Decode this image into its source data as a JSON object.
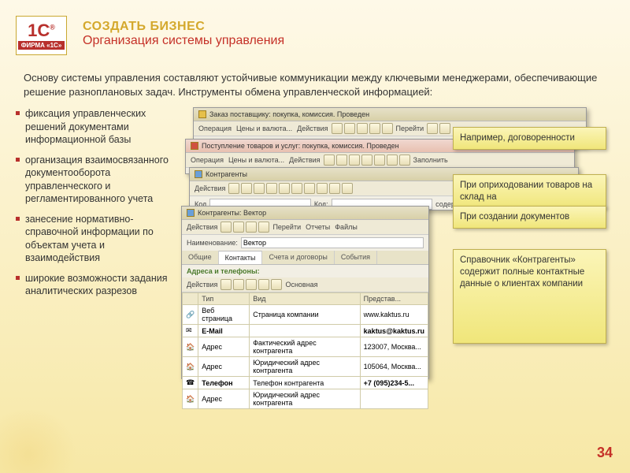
{
  "header": {
    "logo_top": "1С",
    "logo_reg": "®",
    "logo_firm": "ФИРМА «1С»",
    "title_gold": "СОЗДАТЬ БИЗНЕС",
    "title_red": "Организация системы управления"
  },
  "intro": "Основу системы управления составляют устойчивые коммуникации между ключевыми менеджерами, обеспечивающие решение разноплановых задач. Инструменты обмена управленческой информацией:",
  "bullets": [
    "фиксация управленческих решений документами информационной базы",
    "организация взаимосвязанного документооборота управленческого и регламентированного учета",
    "занесение нормативно-справочной информации по объектам учета и взаимодействия",
    "широкие возможности задания аналитических разрезов"
  ],
  "win1": {
    "title": "Заказ поставщику: покупка, комиссия. Проведен",
    "menu1": "Операция",
    "menu2": "Цены и валюта...",
    "menu3": "Действия",
    "menu_go": "Перейти"
  },
  "win2": {
    "title": "Поступление товаров и услуг: покупка, комиссия. Проведен",
    "menu1": "Операция",
    "menu2": "Цены и валюта...",
    "menu3": "Действия",
    "menu_fill": "Заполнить"
  },
  "win3": {
    "title": "Контрагенты",
    "act": "Действия",
    "kod": "Код",
    "kod2": "Код:",
    "contain": "содержит:"
  },
  "win4": {
    "title": "Контрагенты: Вектор",
    "act": "Действия",
    "go": "Перейти",
    "rep": "Отчеты",
    "files": "Файлы",
    "name_l": "Наименование:",
    "name_v": "Вектор",
    "tabs": [
      "Общие",
      "Контакты",
      "Счета и договоры",
      "События"
    ],
    "section": "Адреса и телефоны:",
    "act2": "Действия",
    "main": "Основная",
    "cols": [
      "Тип",
      "Вид",
      "Представ..."
    ],
    "rows": [
      {
        "ico": "url",
        "t": "Веб страница",
        "v": "Страница компании",
        "r": "www.kaktus.ru"
      },
      {
        "ico": "mail",
        "t": "E-Mail",
        "v": "",
        "r": "kaktus@kaktus.ru"
      },
      {
        "ico": "addr",
        "t": "Адрес",
        "v": "Фактический адрес контрагента",
        "r": "123007, Москва..."
      },
      {
        "ico": "addr",
        "t": "Адрес",
        "v": "Юридический адрес контрагента",
        "r": "105064, Москва..."
      },
      {
        "ico": "tel",
        "t": "Телефон",
        "v": "Телефон контрагента",
        "r": "+7 (095)234-5..."
      },
      {
        "ico": "addr",
        "t": "Адрес",
        "v": "Юридический адрес контрагента",
        "r": ""
      }
    ]
  },
  "callouts": {
    "c1": "Например, договоренности",
    "c2": "При оприходовании товаров на склад на",
    "c3": "При создании документов",
    "c4": "Справочник «Контрагенты» содержит полные контактные данные о клиентах компании"
  },
  "page": "34"
}
